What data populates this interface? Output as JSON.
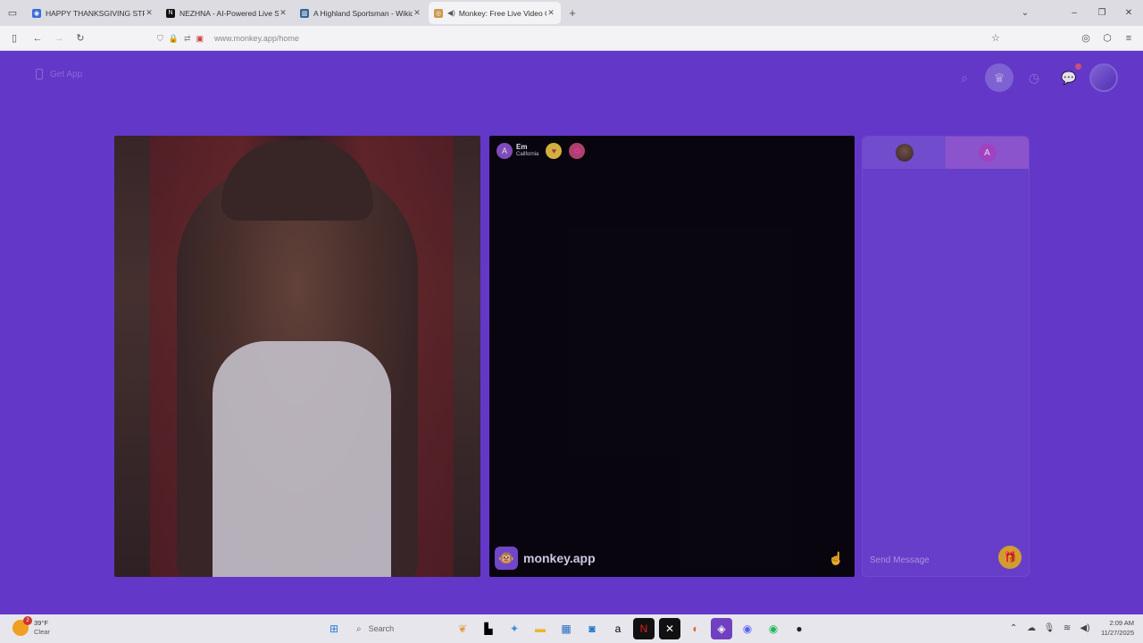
{
  "browser": {
    "tabs": [
      {
        "title": "HAPPY THANKSGIVING STREA",
        "fav_color": "#3a6be0",
        "fav_glyph": "◉",
        "active": false,
        "speaker": false
      },
      {
        "title": "NEZHNA - AI-Powered Live Stre",
        "fav_color": "#111111",
        "fav_glyph": "N",
        "active": false,
        "speaker": false
      },
      {
        "title": "A Highland Sportsman - Wikida",
        "fav_color": "#336699",
        "fav_glyph": "▥",
        "active": false,
        "speaker": false
      },
      {
        "title": "Monkey: Free Live Video Ch",
        "fav_color": "#c89a4a",
        "fav_glyph": "◎",
        "active": true,
        "speaker": true
      }
    ],
    "url": "www.monkey.app/home"
  },
  "page": {
    "get_app_label": "Get App",
    "stranger": {
      "avatar_letter": "A",
      "name": "Em",
      "location": "California"
    },
    "brand": "monkey.app",
    "chat": {
      "tab2_letter": "A",
      "placeholder": "Send Message"
    }
  },
  "taskbar": {
    "weather_temp": "39°F",
    "weather_cond": "Clear",
    "weather_badge": "2",
    "search_placeholder": "Search",
    "time": "2:09 AM",
    "date": "11/27/2025"
  },
  "colors": {
    "page_bg": "#6b3ed8",
    "chat_bg": "#7046da",
    "accent_gift": "#e8b22a"
  }
}
